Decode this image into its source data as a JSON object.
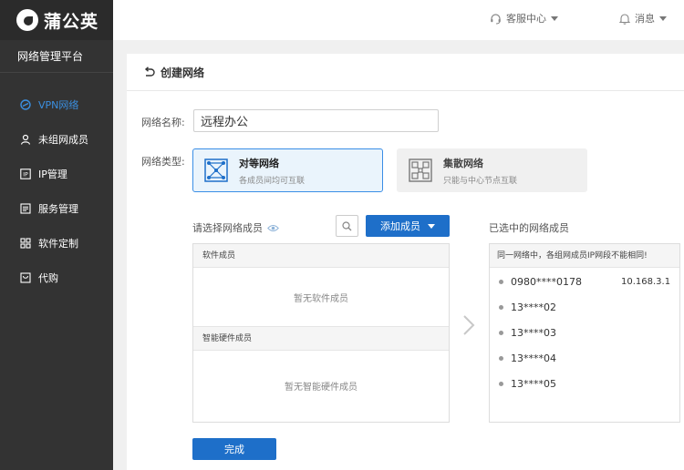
{
  "brand": {
    "logo_text": "蒲公英",
    "platform": "网络管理平台"
  },
  "sidebar": {
    "items": [
      {
        "label": "VPN网络",
        "icon": "vpn-icon",
        "active": true
      },
      {
        "label": "未组网成员",
        "icon": "user-icon",
        "active": false
      },
      {
        "label": "IP管理",
        "icon": "ip-icon",
        "active": false
      },
      {
        "label": "服务管理",
        "icon": "service-icon",
        "active": false
      },
      {
        "label": "软件定制",
        "icon": "grid-icon",
        "active": false
      },
      {
        "label": "代购",
        "icon": "cart-icon",
        "active": false
      }
    ]
  },
  "header": {
    "support": "客服中心",
    "messages": "消息"
  },
  "page": {
    "title": "创建网络",
    "name_label": "网络名称:",
    "name_value": "远程办公",
    "type_label": "网络类型:",
    "types": [
      {
        "name": "对等网络",
        "desc": "各成员间均可互联",
        "selected": true
      },
      {
        "name": "集散网络",
        "desc": "只能与中心节点互联",
        "selected": false
      }
    ],
    "select_title": "请选择网络成员",
    "add_member": "添加成员",
    "software_section": "软件成员",
    "software_empty": "暂无软件成员",
    "hardware_section": "智能硬件成员",
    "hardware_empty": "暂无智能硬件成员",
    "selected_title": "已选中的网络成员",
    "warning": "同一网络中，各组网成员IP网段不能相同!",
    "members": [
      {
        "name": "0980****0178",
        "ip": "10.168.3.1"
      },
      {
        "name": "13****02",
        "ip": ""
      },
      {
        "name": "13****03",
        "ip": ""
      },
      {
        "name": "13****04",
        "ip": ""
      },
      {
        "name": "13****05",
        "ip": ""
      }
    ],
    "done": "完成"
  },
  "colors": {
    "accent": "#1e6fc9",
    "sidebar_bg": "#333333",
    "active_nav": "#3b8fe0"
  }
}
